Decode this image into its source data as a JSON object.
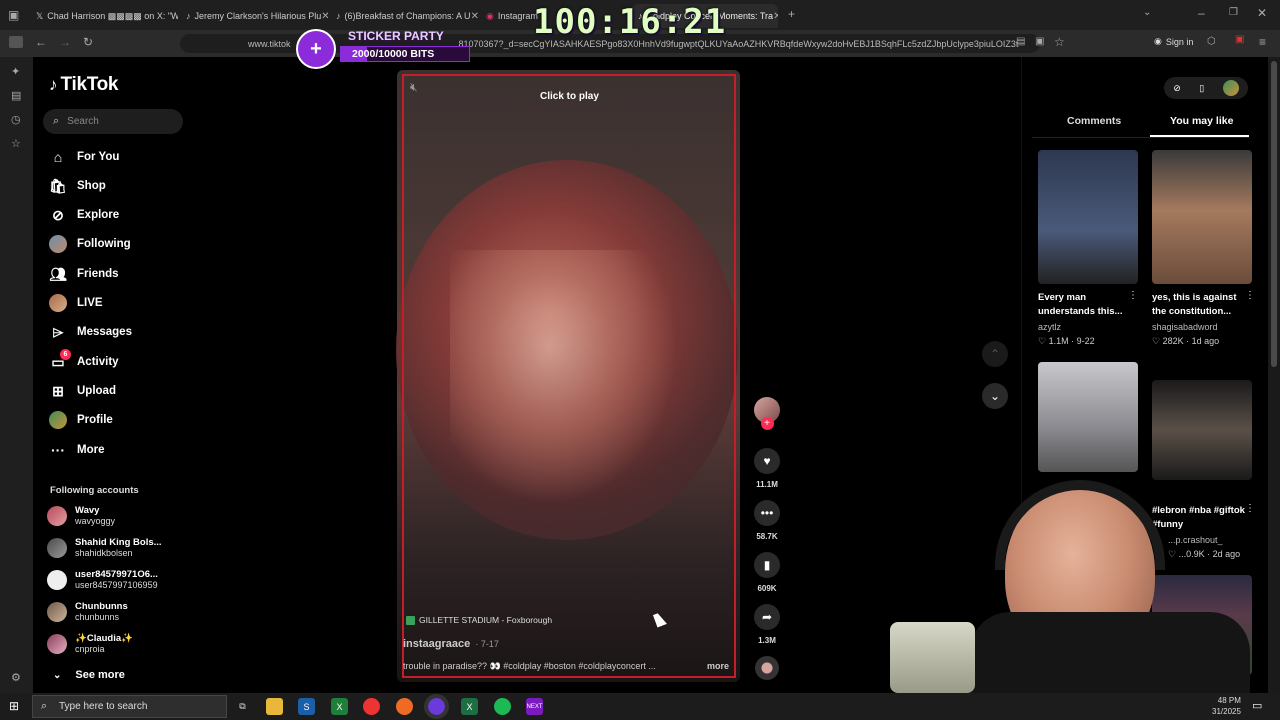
{
  "browser": {
    "tabs": [
      {
        "label": "Chad Harrison ▩▩▩▩ on X: \"W"
      },
      {
        "label": "Jeremy Clarkson's Hilarious Plu"
      },
      {
        "label": "(6)Breakfast of Champions: A U"
      },
      {
        "label": "Instagram"
      },
      {
        "label": "Coldplay Concert Moments: Tra"
      }
    ],
    "url_prefix": "www.tiktok",
    "url_rest": "81070367?_d=secCgYIASAHKAESPgo83X0HnhVd9fugwptQLKUYaAoAZHKVRBqfdeWxyw2doHvEBJ1BSqhFLc5zdZJbpUclype3piuLOIZ3t",
    "sign_in": "Sign in"
  },
  "overlay": {
    "timer": "100:16:21",
    "sticker_title": "STICKER PARTY",
    "sticker_bits": "2000/10000 BITS"
  },
  "sidebar": {
    "logo": "TikTok",
    "search_placeholder": "Search",
    "nav": [
      {
        "label": "For You",
        "icon": "home-icon"
      },
      {
        "label": "Shop",
        "icon": "shop-icon"
      },
      {
        "label": "Explore",
        "icon": "compass-icon"
      },
      {
        "label": "Following",
        "icon": "avatar-icon"
      },
      {
        "label": "Friends",
        "icon": "friends-icon"
      },
      {
        "label": "LIVE",
        "icon": "avatar-icon"
      },
      {
        "label": "Messages",
        "icon": "messages-icon"
      },
      {
        "label": "Activity",
        "icon": "activity-icon",
        "badge": "6"
      },
      {
        "label": "Upload",
        "icon": "upload-icon"
      },
      {
        "label": "Profile",
        "icon": "avatar-icon"
      },
      {
        "label": "More",
        "icon": "more-icon"
      }
    ],
    "following_header": "Following accounts",
    "accounts": [
      {
        "name": "Wavy",
        "handle": "wavyoggy"
      },
      {
        "name": "Shahid King Bols...",
        "handle": "shahidkbolsen"
      },
      {
        "name": "user84579971O6...",
        "handle": "user8457997106959"
      },
      {
        "name": "Chunbunns",
        "handle": "chunbunns"
      },
      {
        "name": "✨Claudia✨",
        "handle": "cnproia"
      }
    ],
    "see_more": "See more"
  },
  "video": {
    "click_to_play": "Click to play",
    "location": "GILLETTE STADIUM - Foxborough",
    "author": "instaagraace",
    "date": "· 7-17",
    "caption": "trouble in paradise?? 👀 #coldplay #boston #coldplayconcert ...",
    "more": "more"
  },
  "actions": {
    "likes": "11.1M",
    "comments": "58.7K",
    "saves": "609K",
    "shares": "1.3M"
  },
  "right_panel": {
    "tabs": [
      "Comments",
      "You may like"
    ],
    "active_tab": "You may like",
    "items": [
      {
        "title": "Every man understands this...",
        "user": "azytlz",
        "stats": "♡ 1.1M · 9-22"
      },
      {
        "title": "yes, this is against the constitution...",
        "user": "shagisabadword",
        "stats": "♡ 282K · 1d ago"
      },
      {
        "title": "",
        "user": "",
        "stats": ""
      },
      {
        "title": "#lebron #nba #giftok #funny",
        "user": "...p.crashout_",
        "stats": "♡ ...0.9K · 2d ago"
      }
    ]
  },
  "taskbar": {
    "search_placeholder": "Type here to search",
    "clock_time": "48 PM",
    "clock_date": "31/2025"
  },
  "colors": {
    "frame_red": "#c41e28",
    "tiktok_pink": "#fe2c55",
    "sticker_purple": "#8b2bd9"
  }
}
